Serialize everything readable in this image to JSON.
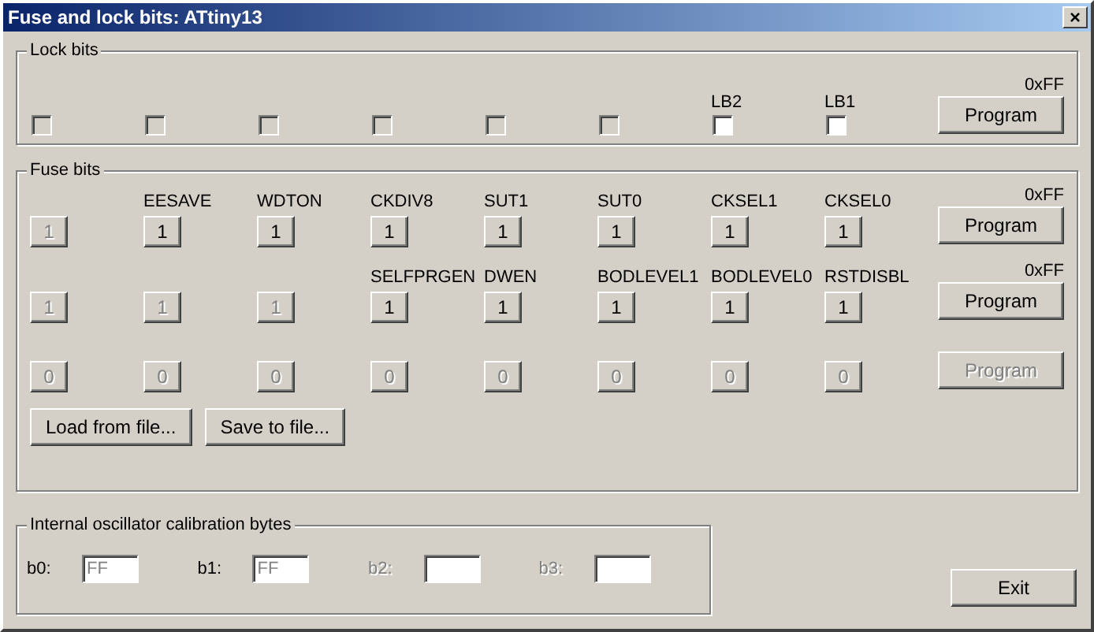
{
  "window": {
    "title": "Fuse and lock bits: ATtiny13",
    "close": "×"
  },
  "lock_bits": {
    "title": "Lock bits",
    "value": "0xFF",
    "button": {
      "label": "Program",
      "disabled": false
    },
    "bits": [
      {
        "checked": false,
        "disabled": true
      },
      {
        "checked": false,
        "disabled": true
      },
      {
        "checked": false,
        "disabled": true
      },
      {
        "checked": false,
        "disabled": true
      },
      {
        "checked": false,
        "disabled": true
      },
      {
        "checked": false,
        "disabled": true
      },
      {
        "label": "LB2",
        "checked": false,
        "disabled": false
      },
      {
        "label": "LB1",
        "checked": false,
        "disabled": false
      }
    ]
  },
  "fuse_bits": {
    "title": "Fuse bits",
    "rows": [
      {
        "value": "0xFF",
        "button": {
          "label": "Program",
          "disabled": false
        },
        "bits": [
          {
            "value": "1",
            "disabled": true
          },
          {
            "label": "EESAVE",
            "value": "1",
            "disabled": false
          },
          {
            "label": "WDTON",
            "value": "1",
            "disabled": false
          },
          {
            "label": "CKDIV8",
            "value": "1",
            "disabled": false
          },
          {
            "label": "SUT1",
            "value": "1",
            "disabled": false
          },
          {
            "label": "SUT0",
            "value": "1",
            "disabled": false
          },
          {
            "label": "CKSEL1",
            "value": "1",
            "disabled": false
          },
          {
            "label": "CKSEL0",
            "value": "1",
            "disabled": false
          }
        ]
      },
      {
        "value": "0xFF",
        "button": {
          "label": "Program",
          "disabled": false
        },
        "bits": [
          {
            "value": "1",
            "disabled": true
          },
          {
            "value": "1",
            "disabled": true
          },
          {
            "value": "1",
            "disabled": true
          },
          {
            "label": "SELFPRGEN",
            "value": "1",
            "disabled": false
          },
          {
            "label": "DWEN",
            "value": "1",
            "disabled": false
          },
          {
            "label": "BODLEVEL1",
            "value": "1",
            "disabled": false
          },
          {
            "label": "BODLEVEL0",
            "value": "1",
            "disabled": false
          },
          {
            "label": "RSTDISBL",
            "value": "1",
            "disabled": false
          }
        ]
      },
      {
        "button": {
          "label": "Program",
          "disabled": true
        },
        "bits": [
          {
            "value": "0",
            "disabled": true
          },
          {
            "value": "0",
            "disabled": true
          },
          {
            "value": "0",
            "disabled": true
          },
          {
            "value": "0",
            "disabled": true
          },
          {
            "value": "0",
            "disabled": true
          },
          {
            "value": "0",
            "disabled": true
          },
          {
            "value": "0",
            "disabled": true
          },
          {
            "value": "0",
            "disabled": true
          }
        ]
      }
    ],
    "buttons": [
      "Load from file...",
      "Save to file..."
    ]
  },
  "calibration": {
    "title": "Internal oscillator calibration bytes",
    "fields": [
      {
        "label": "b0:",
        "value": "FF",
        "disabled": false
      },
      {
        "label": "b1:",
        "value": "FF",
        "disabled": false
      },
      {
        "label": "b2:",
        "disabled": true
      },
      {
        "label": "b3:",
        "disabled": true
      }
    ]
  },
  "exit_button": "Exit"
}
